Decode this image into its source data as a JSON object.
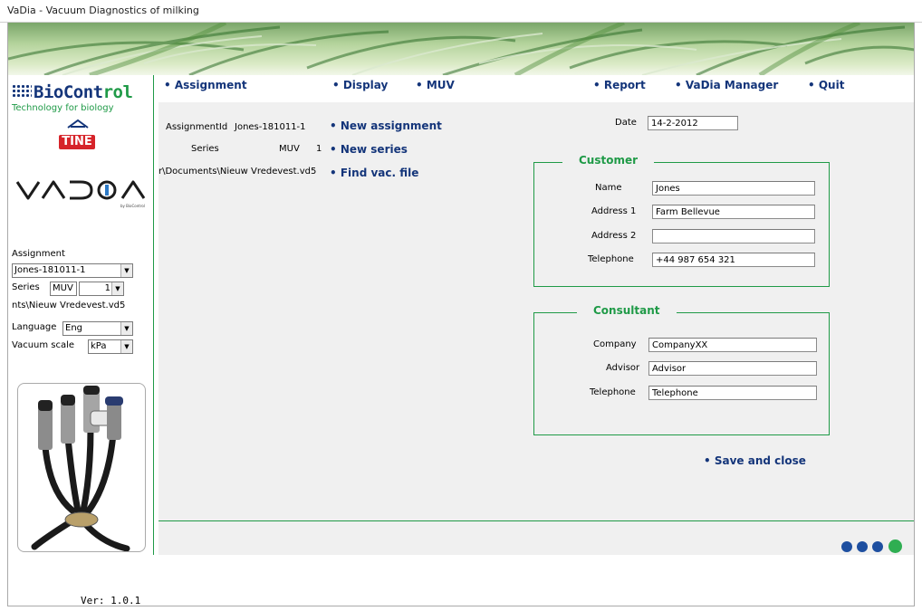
{
  "window": {
    "title": "VaDia - Vacuum Diagnostics of milking"
  },
  "brand": {
    "logo_prefix": "BioCont",
    "logo_suffix": "rol",
    "tagline": "Technology for biology",
    "tine": "TINE",
    "vadia": "VADIA",
    "vadia_sub": "by BioControl"
  },
  "menu": {
    "assignment": "• Assignment",
    "display": "• Display",
    "muv": "• MUV",
    "report": "• Report",
    "manager": "• VaDia Manager",
    "quit": "• Quit"
  },
  "sidebar": {
    "assignment_label": "Assignment",
    "assignment_value": "Jones-181011-1",
    "series_label": "Series",
    "series_type": "MUV",
    "series_number": "1",
    "file": "nts\\Nieuw Vredevest.vd5",
    "language_label": "Language",
    "language_value": "Eng",
    "vacuum_label": "Vacuum scale",
    "vacuum_value": "kPa",
    "version": "Ver: 1.0.1"
  },
  "assignment": {
    "id_label": "AssignmentId",
    "id_value": "Jones-181011-1",
    "series_label": "Series",
    "series_type": "MUV",
    "series_number": "1",
    "file_path": "r\\Documents\\Nieuw Vredevest.vd5",
    "new_assignment": "• New assignment",
    "new_series": "• New series",
    "find_file": "• Find vac. file",
    "date_label": "Date",
    "date_value": "14-2-2012"
  },
  "customer": {
    "title": "Customer",
    "name_label": "Name",
    "name_value": "Jones",
    "address1_label": "Address 1",
    "address1_value": "Farm Bellevue",
    "address2_label": "Address 2",
    "address2_value": "",
    "telephone_label": "Telephone",
    "telephone_value": "+44 987 654 321"
  },
  "consultant": {
    "title": "Consultant",
    "company_label": "Company",
    "company_value": "CompanyXX",
    "advisor_label": "Advisor",
    "advisor_value": "Advisor",
    "telephone_label": "Telephone",
    "telephone_value": "Telephone"
  },
  "actions": {
    "save_close": "• Save and close"
  },
  "colors": {
    "brand_blue": "#14357a",
    "brand_green": "#1f9a47",
    "panel": "#f0f0f0",
    "dot_blue": "#1e4fa0",
    "dot_green": "#2fae52"
  },
  "pager": {
    "dots": 4,
    "active": 4
  }
}
